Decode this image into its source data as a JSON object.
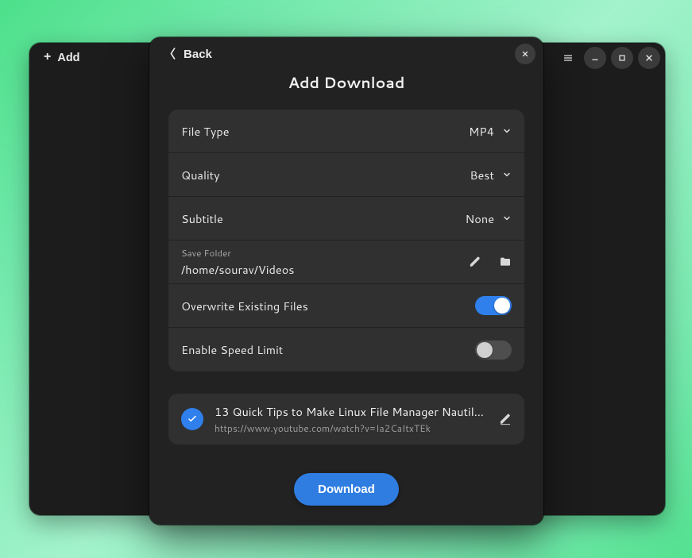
{
  "parent_window": {
    "add_label": "Add"
  },
  "dialog": {
    "back_label": "Back",
    "title": "Add Download",
    "rows": {
      "file_type": {
        "label": "File Type",
        "value": "MP4"
      },
      "quality": {
        "label": "Quality",
        "value": "Best"
      },
      "subtitle": {
        "label": "Subtitle",
        "value": "None"
      },
      "save_folder": {
        "caption": "Save Folder",
        "path": "/home/sourav/Videos"
      },
      "overwrite": {
        "label": "Overwrite Existing Files",
        "on": true
      },
      "speedlimit": {
        "label": "Enable Speed Limit",
        "on": false
      }
    },
    "item": {
      "title": "13 Quick Tips to Make Linux File Manager Nautil…",
      "url": "https://www.youtube.com/watch?v=Ia2CaItxTEk",
      "checked": true
    },
    "download_label": "Download"
  }
}
